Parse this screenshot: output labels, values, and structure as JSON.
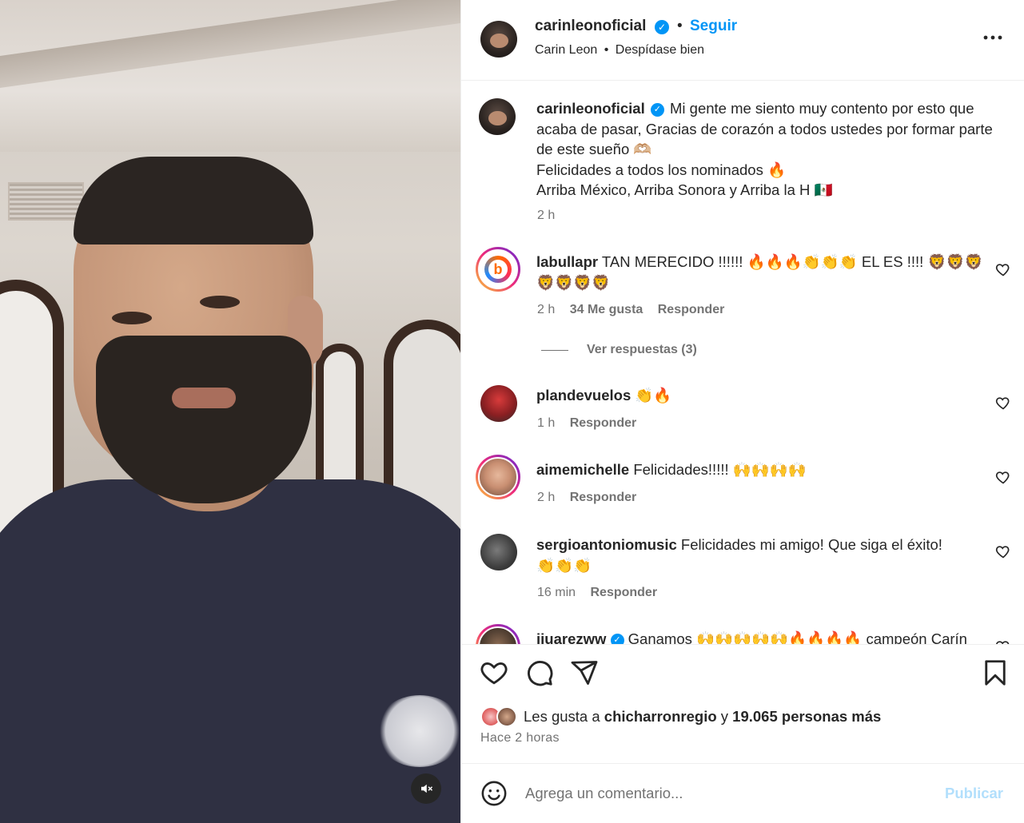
{
  "header": {
    "username": "carinleonoficial",
    "follow_label": "Seguir",
    "separator": "•",
    "artist": "Carin Leon",
    "song": "Despídase bien"
  },
  "caption": {
    "username": "carinleonoficial",
    "line1": "Mi gente me siento muy contento por esto que acaba de pasar, Gracias de corazón a todos ustedes por formar parte de este sueño 🫶🏼",
    "line2": "Felicidades a todos los nominados 🔥",
    "line3": "Arriba México, Arriba Sonora y Arriba la H 🇲🇽",
    "time": "2 h"
  },
  "comments": [
    {
      "username": "labullapr",
      "text": "TAN MERECIDO !!!!!! 🔥🔥🔥👏👏👏 EL ES !!!! 🦁🦁🦁🦁🦁🦁🦁",
      "time": "2 h",
      "likes": "34 Me gusta",
      "reply": "Responder",
      "view_replies": "Ver respuestas (3)"
    },
    {
      "username": "plandevuelos",
      "text": "👏🔥",
      "time": "1 h",
      "reply": "Responder"
    },
    {
      "username": "aimemichelle",
      "text": "Felicidades!!!!! 🙌🙌🙌🙌",
      "time": "2 h",
      "reply": "Responder"
    },
    {
      "username": "sergioantoniomusic",
      "text": "Felicidades mi amigo! Que siga el éxito! 👏👏👏",
      "time": "16 min",
      "reply": "Responder"
    },
    {
      "username": "jjuarezww",
      "text": "Ganamos 🙌🙌🙌🙌🙌🔥🔥🔥🔥 campeón Carín",
      "time": "",
      "reply": ""
    }
  ],
  "likes": {
    "prefix": "Les gusta a",
    "user": "chicharronregio",
    "connector": "y",
    "others": "19.065 personas más"
  },
  "time_ago": "Hace 2 horas",
  "composer": {
    "placeholder": "Agrega un comentario...",
    "publish_label": "Publicar"
  },
  "colors": {
    "accent": "#0095f6",
    "muted": "#737373",
    "publish_disabled": "#b2dffc"
  },
  "icons": [
    "verified-icon",
    "more-icon",
    "heart-icon",
    "comment-icon",
    "share-icon",
    "bookmark-icon",
    "emoji-icon",
    "mute-icon"
  ]
}
